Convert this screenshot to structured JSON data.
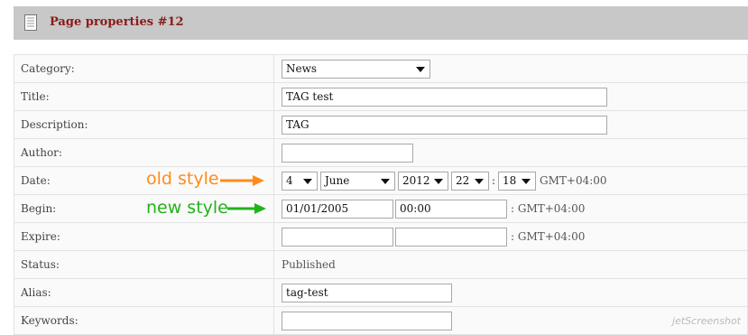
{
  "header": {
    "title": "Page properties #12",
    "icon": "document-icon"
  },
  "fields": {
    "category": {
      "label": "Category:",
      "value": "News"
    },
    "title": {
      "label": "Title:",
      "value": "TAG test"
    },
    "description": {
      "label": "Description:",
      "value": "TAG"
    },
    "author": {
      "label": "Author:",
      "value": ""
    },
    "date": {
      "label": "Date:",
      "day": "4",
      "month": "June",
      "year": "2012",
      "hour": "22",
      "minute": "18",
      "separator": ":",
      "tz": "GMT+04:00"
    },
    "begin": {
      "label": "Begin:",
      "date": "01/01/2005",
      "time": "00:00",
      "tz": ": GMT+04:00"
    },
    "expire": {
      "label": "Expire:",
      "date": "",
      "time": "",
      "tz": ": GMT+04:00"
    },
    "status": {
      "label": "Status:",
      "value": "Published"
    },
    "alias": {
      "label": "Alias:",
      "value": "tag-test"
    },
    "keywords": {
      "label": "Keywords:",
      "value": ""
    }
  },
  "annotations": {
    "old_style": {
      "text": "old style",
      "color": "#ff8c1a"
    },
    "new_style": {
      "text": "new style",
      "color": "#22b31a"
    }
  },
  "watermark": "jetScreenshot"
}
